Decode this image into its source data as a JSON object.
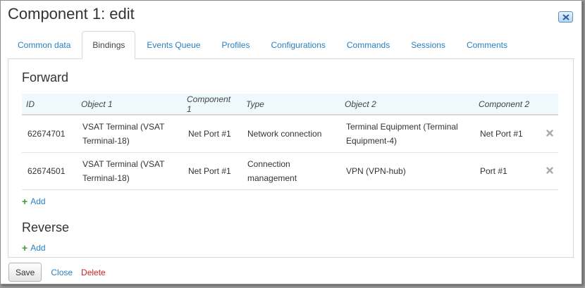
{
  "dialog": {
    "title": "Component 1: edit"
  },
  "tabs": [
    {
      "label": "Common data",
      "active": false
    },
    {
      "label": "Bindings",
      "active": true
    },
    {
      "label": "Events Queue",
      "active": false
    },
    {
      "label": "Profiles",
      "active": false
    },
    {
      "label": "Configurations",
      "active": false
    },
    {
      "label": "Commands",
      "active": false
    },
    {
      "label": "Sessions",
      "active": false
    },
    {
      "label": "Comments",
      "active": false
    }
  ],
  "forward": {
    "title": "Forward",
    "columns": [
      "ID",
      "Object 1",
      "Component 1",
      "Type",
      "Object 2",
      "Component 2"
    ],
    "rows": [
      {
        "id": "62674701",
        "object1": "VSAT Terminal (VSAT Terminal-18)",
        "component1": "Net Port #1",
        "type": "Network connection",
        "object2": "Terminal Equipment (Terminal Equipment-4)",
        "component2": "Net Port #1"
      },
      {
        "id": "62674501",
        "object1": "VSAT Terminal (VSAT Terminal-18)",
        "component1": "Net Port #1",
        "type": "Connection management",
        "object2": "VPN (VPN-hub)",
        "component2": "Port #1"
      }
    ],
    "add_label": "Add"
  },
  "reverse": {
    "title": "Reverse",
    "add_label": "Add"
  },
  "footer": {
    "save_label": "Save",
    "close_label": "Close",
    "delete_label": "Delete"
  },
  "colors": {
    "link": "#2a7fc0",
    "danger": "#cc2222",
    "add_plus": "#3b9b3b",
    "header_bg": "#eef8fd"
  },
  "icons": {
    "close": "close-icon",
    "delete": "remove-icon",
    "add": "plus-icon"
  }
}
